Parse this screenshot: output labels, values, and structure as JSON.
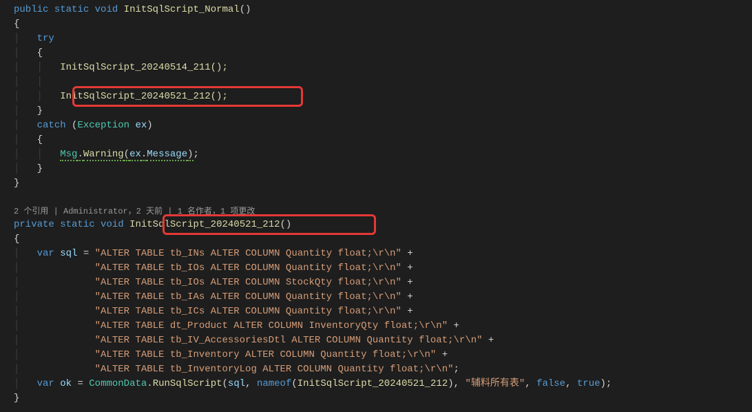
{
  "method1": {
    "signature": {
      "mod1": "public",
      "mod2": "static",
      "ret": "void",
      "name": "InitSqlScript_Normal",
      "parens": "()"
    },
    "try": "try",
    "call1": "InitSqlScript_20240514_211();",
    "call2": "InitSqlScript_20240521_212();",
    "catch": "catch",
    "exType": "Exception",
    "exVar": "ex",
    "msgClass": "Msg",
    "warnMethod": "Warning",
    "exVar2": "ex",
    "msgProp": "Message"
  },
  "codelens": "2 个引用 | Administrator，2 天前 | 1 名作者，1 项更改",
  "method2": {
    "signature": {
      "mod1": "private",
      "mod2": "static",
      "ret": "void",
      "name": "InitSqlScript_20240521_212",
      "parens": "()"
    },
    "var": "var",
    "sqlVar": "sql",
    "lines": [
      "\"ALTER TABLE tb_INs ALTER COLUMN Quantity float;\\r\\n\"",
      "\"ALTER TABLE tb_IOs ALTER COLUMN Quantity float;\\r\\n\"",
      "\"ALTER TABLE tb_IOs ALTER COLUMN StockQty float;\\r\\n\"",
      "\"ALTER TABLE tb_IAs ALTER COLUMN Quantity float;\\r\\n\"",
      "\"ALTER TABLE tb_ICs ALTER COLUMN Quantity float;\\r\\n\"",
      "\"ALTER TABLE dt_Product ALTER COLUMN InventoryQty float;\\r\\n\"",
      "\"ALTER TABLE tb_IV_AccessoriesDtl ALTER COLUMN Quantity float;\\r\\n\"",
      "\"ALTER TABLE tb_Inventory ALTER COLUMN Quantity float;\\r\\n\"",
      "\"ALTER TABLE tb_InventoryLog ALTER COLUMN Quantity float;\\r\\n\""
    ],
    "okVar": "ok",
    "commonData": "CommonData",
    "runMethod": "RunSqlScript",
    "nameof": "nameof",
    "nameofArg": "InitSqlScript_20240521_212",
    "strArg": "\"辅料所有表\"",
    "false": "false",
    "true": "true"
  }
}
